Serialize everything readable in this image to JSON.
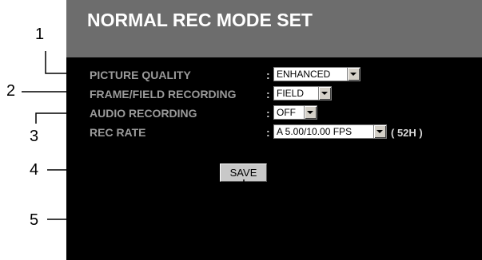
{
  "title": "NORMAL REC MODE SET",
  "rows": [
    {
      "label": "PICTURE QUALITY",
      "colon": ":",
      "value": "ENHANCED"
    },
    {
      "label": "FRAME/FIELD RECORDING",
      "colon": ":",
      "value": "FIELD"
    },
    {
      "label": "AUDIO RECORDING",
      "colon": ":",
      "value": "OFF"
    },
    {
      "label": "REC RATE",
      "colon": ":",
      "value": "A 5.00/10.00 FPS",
      "suffix": "( 52H )"
    }
  ],
  "save_label": "SAVE",
  "callouts": [
    "1",
    "2",
    "3",
    "4",
    "5"
  ]
}
